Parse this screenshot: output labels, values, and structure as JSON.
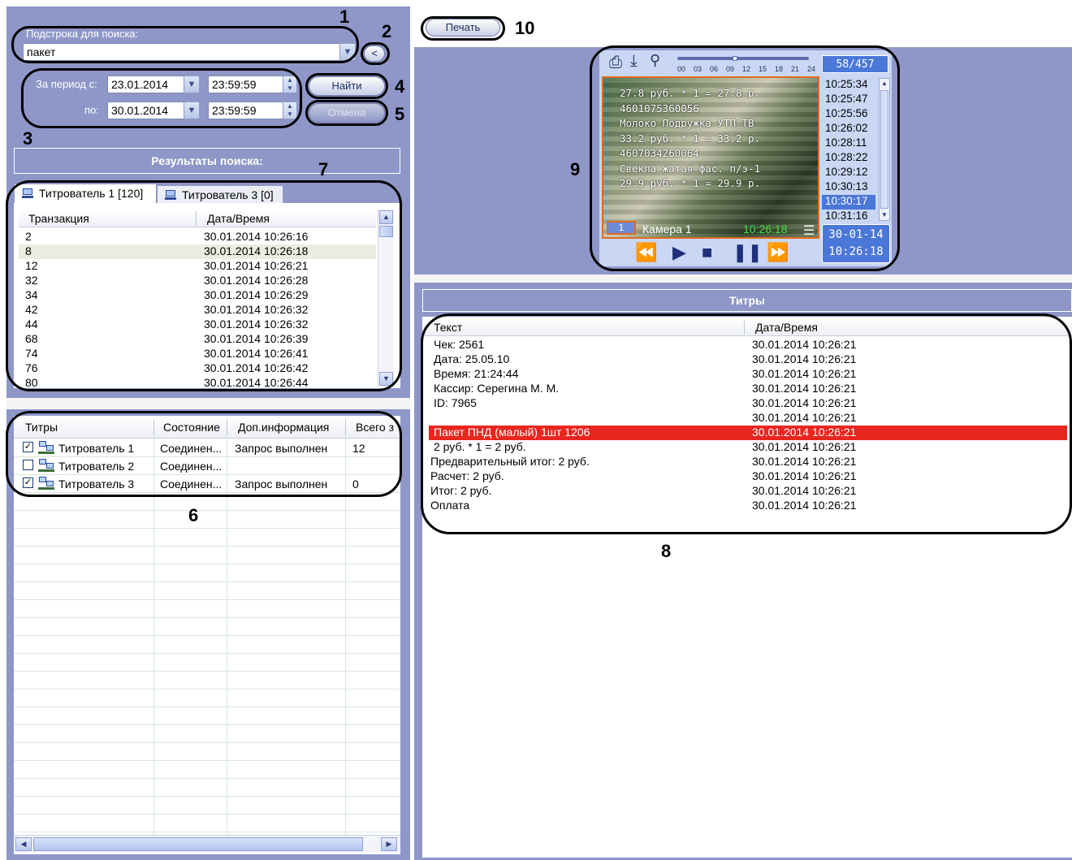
{
  "colors": {
    "panel": "#8e97c8",
    "highlight_row": "#e8261f",
    "selected_row": "#e8ebd8",
    "accent_blue": "#4a77d8"
  },
  "search": {
    "substring_label": "Подстрока для поиска:",
    "substring_value": "пакет",
    "back_label": "<",
    "period_from_label": "За период с:",
    "period_to_label": "по:",
    "from_date": "23.01.2014",
    "from_time": "23:59:59",
    "to_date": "30.01.2014",
    "to_time": "23:59:59",
    "find_label": "Найти",
    "cancel_label": "Отмена"
  },
  "results": {
    "title": "Результаты поиска:",
    "tabs": [
      {
        "label": "Титрователь 1 [120]"
      },
      {
        "label": "Титрователь 3 [0]"
      }
    ],
    "columns": [
      "Транзакция",
      "Дата/Время"
    ],
    "rows": [
      [
        "2",
        "30.01.2014 10:26:16"
      ],
      [
        "8",
        "30.01.2014 10:26:18"
      ],
      [
        "12",
        "30.01.2014 10:26:21"
      ],
      [
        "32",
        "30.01.2014 10:26:28"
      ],
      [
        "34",
        "30.01.2014 10:26:29"
      ],
      [
        "42",
        "30.01.2014 10:26:32"
      ],
      [
        "44",
        "30.01.2014 10:26:32"
      ],
      [
        "68",
        "30.01.2014 10:26:39"
      ],
      [
        "74",
        "30.01.2014 10:26:41"
      ],
      [
        "76",
        "30.01.2014 10:26:42"
      ],
      [
        "80",
        "30.01.2014 10:26:44"
      ]
    ]
  },
  "titrators": {
    "columns": [
      "Титры",
      "Состояние",
      "Доп.информация",
      "Всего з"
    ],
    "rows": [
      {
        "checked": true,
        "name": "Титрователь 1",
        "state": "Соединен...",
        "info": "Запрос выполнен",
        "total": "12"
      },
      {
        "checked": false,
        "name": "Титрователь 2",
        "state": "Соединен...",
        "info": "",
        "total": ""
      },
      {
        "checked": true,
        "name": "Титрователь 3",
        "state": "Соединен...",
        "info": "Запрос выполнен",
        "total": "0"
      }
    ]
  },
  "toolbar": {
    "print_label": "Печать"
  },
  "video": {
    "counter": "58/457",
    "timeline_ticks": [
      "00",
      "03",
      "06",
      "09",
      "12",
      "15",
      "18",
      "21",
      "24"
    ],
    "times": [
      "10:25:34",
      "10:25:47",
      "10:25:56",
      "10:26:02",
      "10:28:11",
      "10:28:22",
      "10:29:12",
      "10:30:13",
      "10:30:17",
      "10:31:16"
    ],
    "selected_time_index": 8,
    "overlay_lines": [
      "27.8 руб. * 1 = 27.8 р.",
      "4601075360056",
      "Молоко Подружка УТП ТВ",
      "33.2 руб. * 1 = 33.2 р.",
      "4607034260064",
      "Свекла жатая фас. п/э-1",
      "29.9 руб. * 1 = 29.9 р."
    ],
    "camera_number": "1",
    "camera_name": "Камера 1",
    "camera_time": "10:26:18",
    "date": "30-01-14",
    "time": "10:26:18"
  },
  "titles": {
    "header": "Титры",
    "columns": [
      "Текст",
      "Дата/Время"
    ],
    "rows": [
      [
        "Чек: 2561",
        "30.01.2014 10:26:21"
      ],
      [
        "Дата: 25.05.10",
        "30.01.2014 10:26:21"
      ],
      [
        "Время: 21:24:44",
        "30.01.2014 10:26:21"
      ],
      [
        "Кассир: Серегина М. М.",
        "30.01.2014 10:26:21"
      ],
      [
        "ID: 7965",
        "30.01.2014 10:26:21"
      ],
      [
        "",
        "30.01.2014 10:26:21"
      ],
      [
        "Пакет ПНД (малый) 1шт 1206",
        "30.01.2014 10:26:21"
      ],
      [
        "2 руб. * 1 = 2 руб.",
        "30.01.2014 10:26:21"
      ],
      [
        "Предварительный итог: 2 руб.",
        "30.01.2014 10:26:21"
      ],
      [
        "Расчет: 2 руб.",
        "30.01.2014 10:26:21"
      ],
      [
        "Итог: 2 руб.",
        "30.01.2014 10:26:21"
      ],
      [
        "Оплата",
        "30.01.2014 10:26:21"
      ]
    ],
    "highlighted_index": 6
  },
  "callouts": [
    "1",
    "2",
    "3",
    "4",
    "5",
    "6",
    "7",
    "8",
    "9",
    "10"
  ]
}
